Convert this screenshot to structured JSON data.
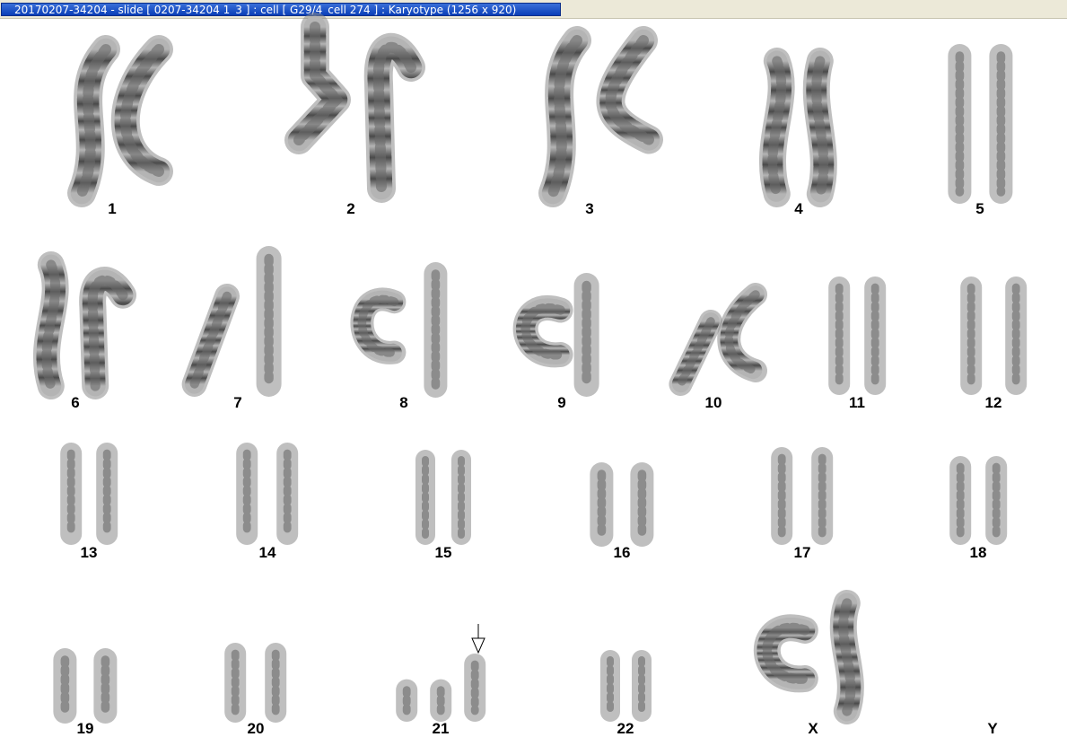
{
  "window": {
    "title": "20170207-34204 - slide [ 0207-34204 1_3 ] : cell [ G29/4_cell 274 ] : Karyotype  (1256 x 920)"
  },
  "colors": {
    "title_tab": "#0a3fb8",
    "chromosome_dark": "#4a4a4a",
    "chromosome_light": "#b4b4b4"
  },
  "karyotype": {
    "chromosomes": [
      {
        "label": "1",
        "copies": 2
      },
      {
        "label": "2",
        "copies": 2
      },
      {
        "label": "3",
        "copies": 2
      },
      {
        "label": "4",
        "copies": 2
      },
      {
        "label": "5",
        "copies": 2
      },
      {
        "label": "6",
        "copies": 2
      },
      {
        "label": "7",
        "copies": 2
      },
      {
        "label": "8",
        "copies": 2
      },
      {
        "label": "9",
        "copies": 2
      },
      {
        "label": "10",
        "copies": 2
      },
      {
        "label": "11",
        "copies": 2
      },
      {
        "label": "12",
        "copies": 2
      },
      {
        "label": "13",
        "copies": 2
      },
      {
        "label": "14",
        "copies": 2
      },
      {
        "label": "15",
        "copies": 2
      },
      {
        "label": "16",
        "copies": 2
      },
      {
        "label": "17",
        "copies": 2
      },
      {
        "label": "18",
        "copies": 2
      },
      {
        "label": "19",
        "copies": 2
      },
      {
        "label": "20",
        "copies": 2
      },
      {
        "label": "21",
        "copies": 3,
        "marked": true
      },
      {
        "label": "22",
        "copies": 2
      },
      {
        "label": "X",
        "copies": 2
      },
      {
        "label": "Y",
        "copies": 0
      }
    ]
  }
}
